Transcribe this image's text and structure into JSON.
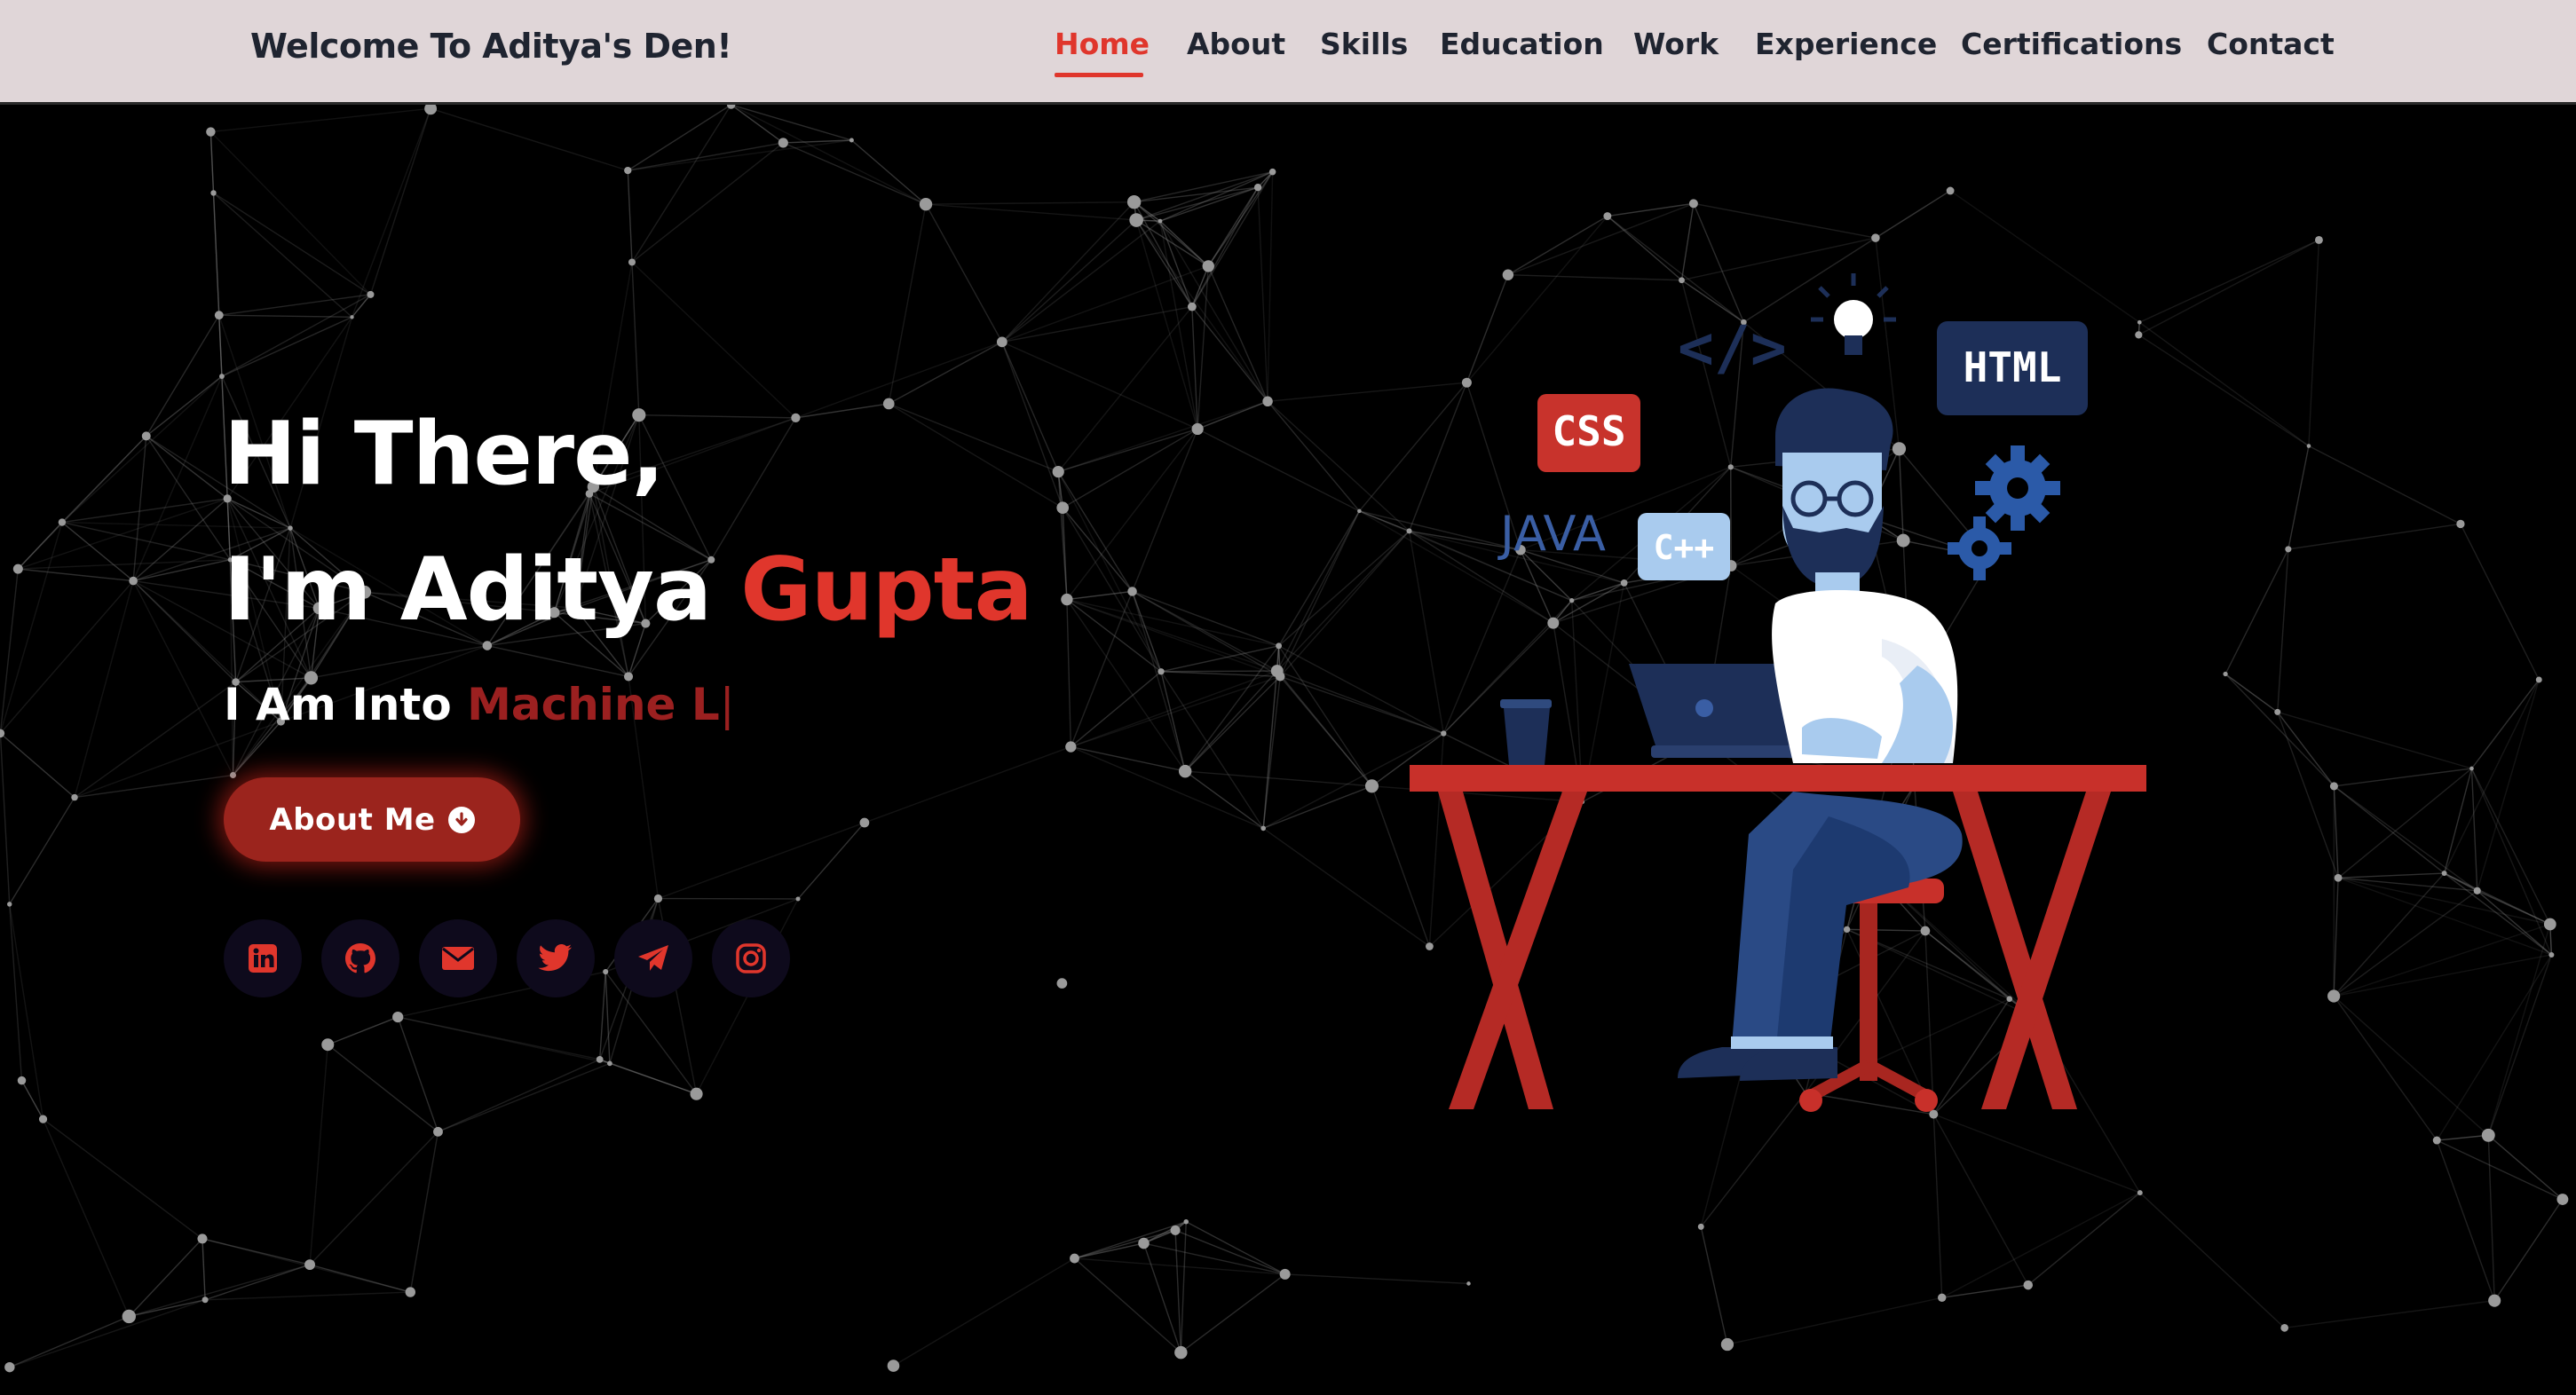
{
  "nav": {
    "brand": "Welcome To Aditya's Den!",
    "items": [
      {
        "label": "Home",
        "active": true
      },
      {
        "label": "About"
      },
      {
        "label": "Skills"
      },
      {
        "label": "Education"
      },
      {
        "label": "Work"
      },
      {
        "label": "Experience"
      },
      {
        "label": "Certifications"
      },
      {
        "label": "Contact"
      }
    ]
  },
  "hero": {
    "greeting": "Hi There,",
    "intro_prefix": "I'm Aditya ",
    "intro_name_accent": "Gupta",
    "typing_prefix": "I Am Into ",
    "typing_text": "Machine L",
    "typing_cursor": "|",
    "button_label": "About Me",
    "button_icon": "arrow-circle-down-icon"
  },
  "socials": [
    {
      "name": "linkedin-icon"
    },
    {
      "name": "github-icon"
    },
    {
      "name": "envelope-icon"
    },
    {
      "name": "twitter-icon"
    },
    {
      "name": "telegram-icon"
    },
    {
      "name": "instagram-icon"
    }
  ],
  "illustration": {
    "tags": [
      "CSS",
      "HTML",
      "JAVA",
      "C++",
      "</>"
    ]
  },
  "colors": {
    "accent": "#e0362c",
    "accent_dark": "#9b241d",
    "nav_bg": "#e0d6d8",
    "nav_text": "#1f2430",
    "background": "#000000",
    "social_bg": "#0e0a1c"
  }
}
